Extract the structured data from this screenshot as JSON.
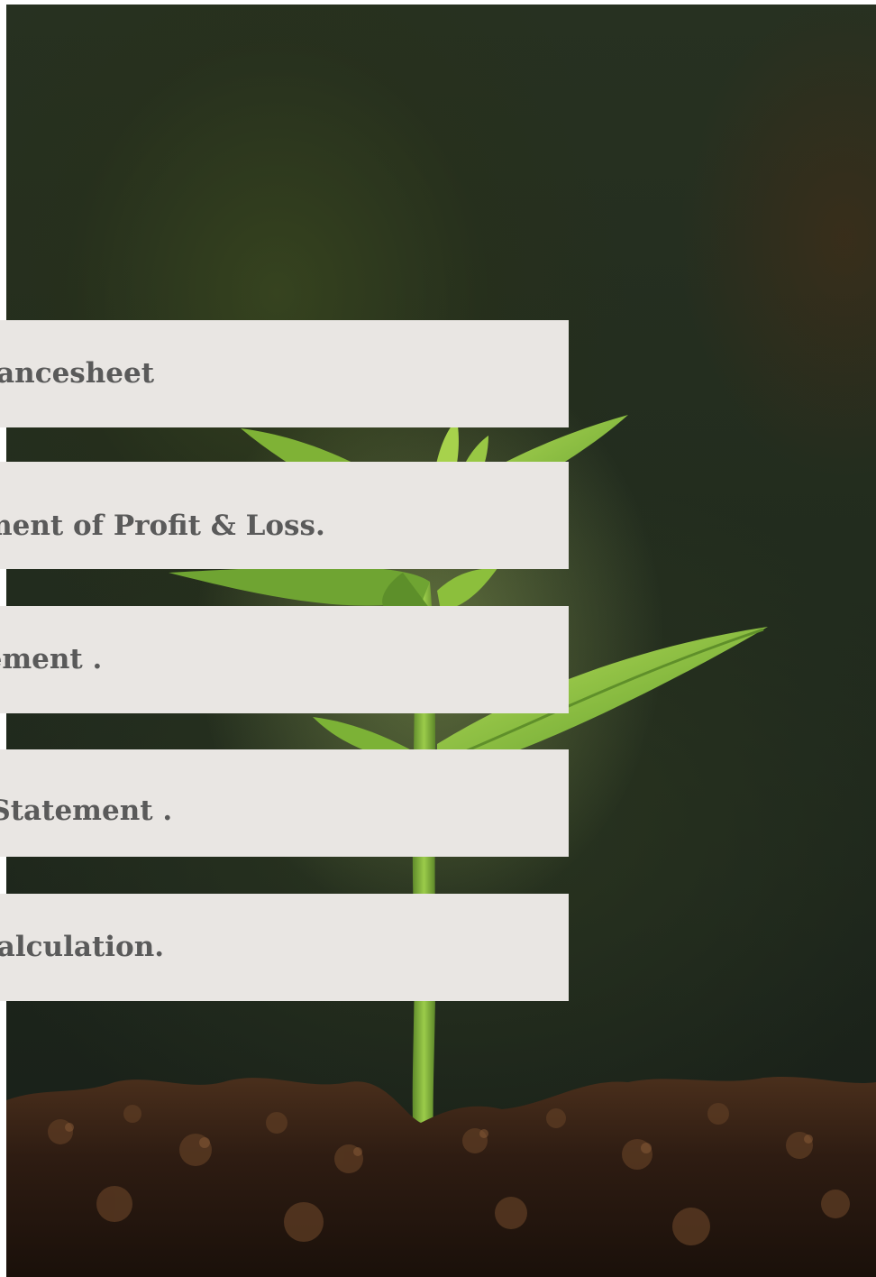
{
  "menu": {
    "items": [
      {
        "label": "Balancesheet"
      },
      {
        "label": "Statement of Profit & Loss."
      },
      {
        "label": "Cash Flow Statement ."
      },
      {
        "label": "Notes to Financial Statement ."
      },
      {
        "label": "Ratio Calculation."
      }
    ]
  },
  "colors": {
    "panel": "#e9e6e3",
    "text": "#5a5a5a",
    "background_dark": "#222c1e",
    "leaf": "#8fc23a",
    "stem": "#7aa83a",
    "soil": "#3a2416"
  },
  "image": {
    "subject": "seedling-in-soil"
  }
}
